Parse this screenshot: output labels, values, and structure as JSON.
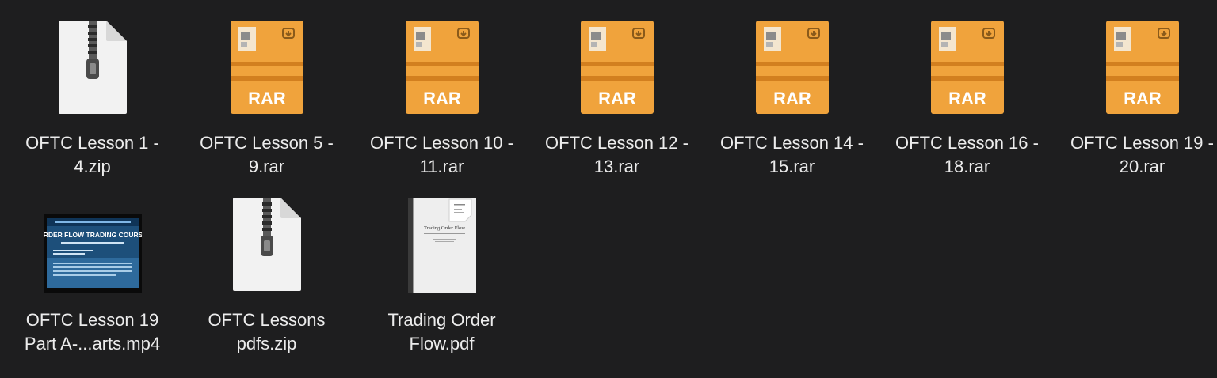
{
  "files": [
    {
      "type": "zip",
      "badge": "ZIP",
      "name": "OFTC Lesson 1 -\n4.zip"
    },
    {
      "type": "rar",
      "badge": "RAR",
      "name": "OFTC Lesson 5 -\n9.rar"
    },
    {
      "type": "rar",
      "badge": "RAR",
      "name": "OFTC Lesson 10 -\n11.rar"
    },
    {
      "type": "rar",
      "badge": "RAR",
      "name": "OFTC Lesson 12 -\n13.rar"
    },
    {
      "type": "rar",
      "badge": "RAR",
      "name": "OFTC Lesson 14 -\n15.rar"
    },
    {
      "type": "rar",
      "badge": "RAR",
      "name": "OFTC Lesson 16 -\n18.rar"
    },
    {
      "type": "rar",
      "badge": "RAR",
      "name": "OFTC Lesson 19 -\n20.rar"
    },
    {
      "type": "video",
      "badge": "",
      "name": "OFTC Lesson 19\nPart A-...arts.mp4",
      "thumb_title": "ORDER FLOW TRADING COURSE"
    },
    {
      "type": "zip",
      "badge": "ZIP",
      "name": "OFTC Lessons\npdfs.zip"
    },
    {
      "type": "pdf",
      "badge": "",
      "name": "Trading Order\nFlow.pdf",
      "thumb_title": "Trading Order Flow"
    }
  ],
  "colors": {
    "background": "#1e1e1f",
    "rar": "#f0a33c",
    "rar_dark": "#d27f1f",
    "zip": "#f2f2f2",
    "label": "#ececec"
  }
}
